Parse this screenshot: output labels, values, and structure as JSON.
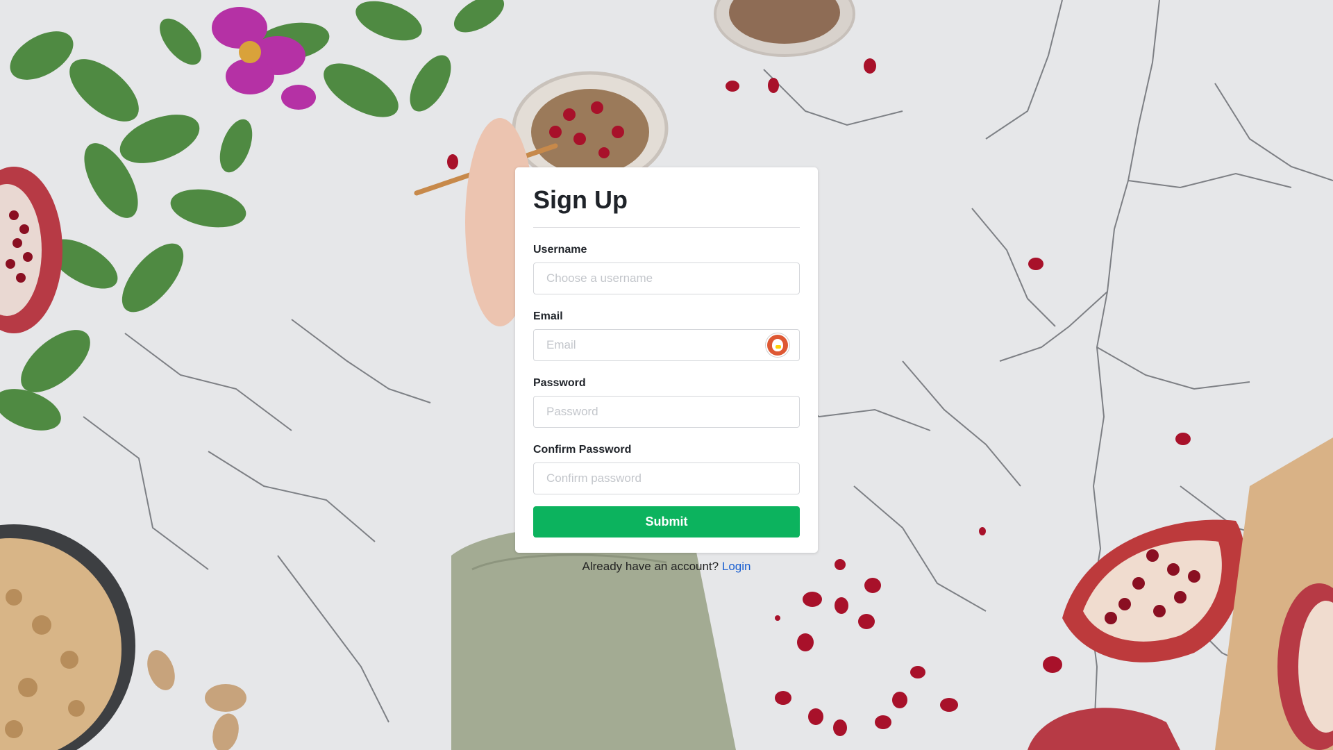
{
  "form": {
    "title": "Sign Up",
    "fields": [
      {
        "label": "Username",
        "placeholder": "Choose a username",
        "value": ""
      },
      {
        "label": "Email",
        "placeholder": "Email",
        "value": ""
      },
      {
        "label": "Password",
        "placeholder": "Password",
        "value": ""
      },
      {
        "label": "Confirm Password",
        "placeholder": "Confirm password",
        "value": ""
      }
    ],
    "submit_label": "Submit",
    "account_prompt": "Already have an account?",
    "login_link": "Login"
  },
  "icons": {
    "email_autofill": "duckduckgo-autofill-icon"
  },
  "colors": {
    "submit_bg": "#0cb35e",
    "link": "#1a5fd1",
    "background": "#e6e7e9"
  }
}
